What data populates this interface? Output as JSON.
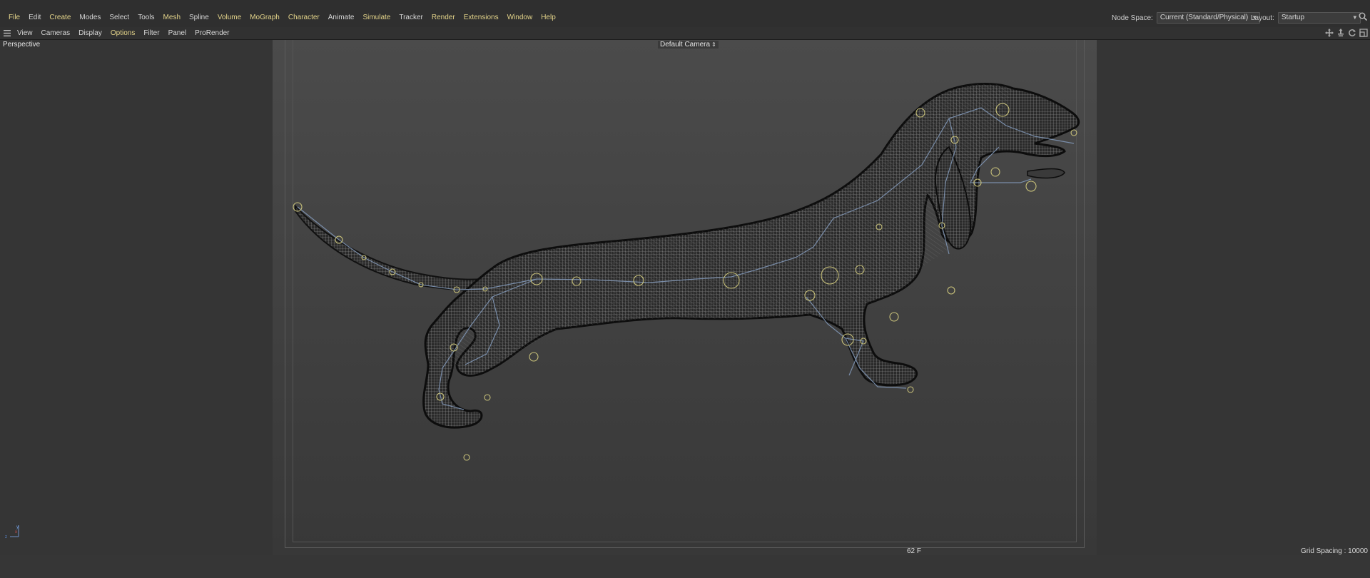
{
  "menu": {
    "items": [
      {
        "label": "File",
        "hl": true
      },
      {
        "label": "Edit",
        "hl": false
      },
      {
        "label": "Create",
        "hl": true
      },
      {
        "label": "Modes",
        "hl": false
      },
      {
        "label": "Select",
        "hl": false
      },
      {
        "label": "Tools",
        "hl": false
      },
      {
        "label": "Mesh",
        "hl": true
      },
      {
        "label": "Spline",
        "hl": false
      },
      {
        "label": "Volume",
        "hl": true
      },
      {
        "label": "MoGraph",
        "hl": true
      },
      {
        "label": "Character",
        "hl": true
      },
      {
        "label": "Animate",
        "hl": false
      },
      {
        "label": "Simulate",
        "hl": true
      },
      {
        "label": "Tracker",
        "hl": false
      },
      {
        "label": "Render",
        "hl": true
      },
      {
        "label": "Extensions",
        "hl": true
      },
      {
        "label": "Window",
        "hl": true
      },
      {
        "label": "Help",
        "hl": true
      }
    ]
  },
  "node_space": {
    "label": "Node Space:",
    "value": "Current (Standard/Physical)"
  },
  "layout": {
    "label": "Layout:",
    "value": "Startup"
  },
  "viewport_menu": {
    "items": [
      {
        "label": "View",
        "hl": false
      },
      {
        "label": "Cameras",
        "hl": false
      },
      {
        "label": "Display",
        "hl": false
      },
      {
        "label": "Options",
        "hl": true
      },
      {
        "label": "Filter",
        "hl": false
      },
      {
        "label": "Panel",
        "hl": false
      },
      {
        "label": "ProRender",
        "hl": false
      }
    ]
  },
  "viewport": {
    "projection": "Perspective",
    "camera": "Default Camera",
    "frame": "62 F",
    "grid_spacing": "Grid Spacing : 10000 cm"
  },
  "colors": {
    "highlight_menu": "#e4d48a",
    "viewport_bg": "#4b4b4b",
    "bone_lines": "#7f95b4",
    "joint_circles": "#c9c27a"
  },
  "icons": [
    "hamburger-icon",
    "search-icon",
    "move-view-icon",
    "pan-view-icon",
    "rotate-view-icon",
    "maximize-view-icon",
    "camera-icon",
    "axis-gizmo"
  ]
}
